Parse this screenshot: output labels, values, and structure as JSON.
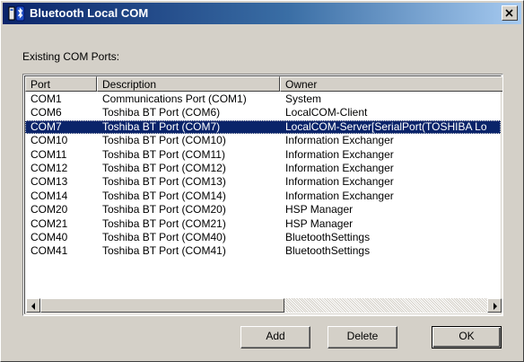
{
  "window": {
    "title": "Bluetooth Local COM",
    "icon": "bluetooth-com-icon",
    "close_symbol": "×"
  },
  "caption": "Existing COM Ports:",
  "list": {
    "columns": [
      "Port",
      "Description",
      "Owner"
    ],
    "selected_index": 2,
    "rows": [
      {
        "port": "COM1",
        "description": "Communications Port (COM1)",
        "owner": "System"
      },
      {
        "port": "COM6",
        "description": "Toshiba BT Port (COM6)",
        "owner": "LocalCOM-Client"
      },
      {
        "port": "COM7",
        "description": "Toshiba BT Port (COM7)",
        "owner": "LocalCOM-Server[SerialPort(TOSHIBA Lo"
      },
      {
        "port": "COM10",
        "description": "Toshiba BT Port (COM10)",
        "owner": "Information Exchanger"
      },
      {
        "port": "COM11",
        "description": "Toshiba BT Port (COM11)",
        "owner": "Information Exchanger"
      },
      {
        "port": "COM12",
        "description": "Toshiba BT Port (COM12)",
        "owner": "Information Exchanger"
      },
      {
        "port": "COM13",
        "description": "Toshiba BT Port (COM13)",
        "owner": "Information Exchanger"
      },
      {
        "port": "COM14",
        "description": "Toshiba BT Port (COM14)",
        "owner": "Information Exchanger"
      },
      {
        "port": "COM20",
        "description": "Toshiba BT Port (COM20)",
        "owner": "HSP Manager"
      },
      {
        "port": "COM21",
        "description": "Toshiba BT Port (COM21)",
        "owner": "HSP Manager"
      },
      {
        "port": "COM40",
        "description": "Toshiba BT Port (COM40)",
        "owner": "BluetoothSettings"
      },
      {
        "port": "COM41",
        "description": "Toshiba BT Port (COM41)",
        "owner": "BluetoothSettings"
      }
    ]
  },
  "buttons": {
    "add": "Add",
    "delete": "Delete",
    "ok": "OK"
  },
  "colors": {
    "selection": "#0a246a",
    "face": "#d4d0c8"
  }
}
